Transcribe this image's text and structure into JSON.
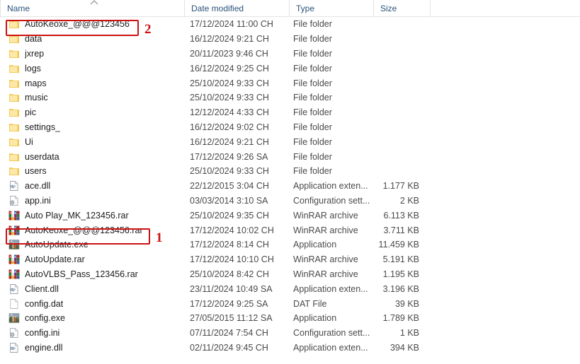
{
  "window": {
    "title": "File Explorer list view"
  },
  "columns": {
    "name": "Name",
    "date_modified": "Date modified",
    "type": "Type",
    "size": "Size",
    "sort_indicator": "sort-ascending-chevron",
    "sorted_by": "Name",
    "sort_direction": "ascending"
  },
  "annotations": [
    {
      "id": "1",
      "label": "1",
      "target": "AutoKeoxe_@@@123456.rar"
    },
    {
      "id": "2",
      "label": "2",
      "target": "AutoKeoxe_@@@123456"
    }
  ],
  "colors": {
    "annotation_red": "#cc1111",
    "folder_yellow": "#fcd975",
    "folder_yellow_dark": "#e8b93c",
    "header_text": "#29527a",
    "row_text": "#1c1c1c",
    "secondary_text": "#4a4a4a"
  },
  "rows": [
    {
      "name": "AutoKeoxe_@@@123456",
      "icon": "folder-icon",
      "date": "17/12/2024 11:00 CH",
      "type": "File folder",
      "size": ""
    },
    {
      "name": "data",
      "icon": "folder-icon",
      "date": "16/12/2024 9:21 CH",
      "type": "File folder",
      "size": ""
    },
    {
      "name": "jxrep",
      "icon": "folder-icon",
      "date": "20/11/2023 9:46 CH",
      "type": "File folder",
      "size": ""
    },
    {
      "name": "logs",
      "icon": "folder-icon",
      "date": "16/12/2024 9:25 CH",
      "type": "File folder",
      "size": ""
    },
    {
      "name": "maps",
      "icon": "folder-icon",
      "date": "25/10/2024 9:33 CH",
      "type": "File folder",
      "size": ""
    },
    {
      "name": "music",
      "icon": "folder-icon",
      "date": "25/10/2024 9:33 CH",
      "type": "File folder",
      "size": ""
    },
    {
      "name": "pic",
      "icon": "folder-icon",
      "date": "12/12/2024 4:33 CH",
      "type": "File folder",
      "size": ""
    },
    {
      "name": "settings_",
      "icon": "folder-icon",
      "date": "16/12/2024 9:02 CH",
      "type": "File folder",
      "size": ""
    },
    {
      "name": "Ui",
      "icon": "folder-icon",
      "date": "16/12/2024 9:21 CH",
      "type": "File folder",
      "size": ""
    },
    {
      "name": "userdata",
      "icon": "folder-icon",
      "date": "17/12/2024 9:26 SA",
      "type": "File folder",
      "size": ""
    },
    {
      "name": "users",
      "icon": "folder-icon",
      "date": "25/10/2024 9:33 CH",
      "type": "File folder",
      "size": ""
    },
    {
      "name": "ace.dll",
      "icon": "dll-icon",
      "date": "22/12/2015 3:04 CH",
      "type": "Application exten...",
      "size": "1.177 KB"
    },
    {
      "name": "app.ini",
      "icon": "ini-icon",
      "date": "03/03/2014 3:10 SA",
      "type": "Configuration sett...",
      "size": "2 KB"
    },
    {
      "name": "Auto Play_MK_123456.rar",
      "icon": "winrar-icon",
      "date": "25/10/2024 9:35 CH",
      "type": "WinRAR archive",
      "size": "6.113 KB"
    },
    {
      "name": "AutoKeoxe_@@@123456.rar",
      "icon": "winrar-icon",
      "date": "17/12/2024 10:02 CH",
      "type": "WinRAR archive",
      "size": "3.711 KB"
    },
    {
      "name": "AutoUpdate.exe",
      "icon": "app-photo-icon",
      "date": "17/12/2024 8:14 CH",
      "type": "Application",
      "size": "11.459 KB"
    },
    {
      "name": "AutoUpdate.rar",
      "icon": "winrar-icon",
      "date": "17/12/2024 10:10 CH",
      "type": "WinRAR archive",
      "size": "5.191 KB"
    },
    {
      "name": "AutoVLBS_Pass_123456.rar",
      "icon": "winrar-icon",
      "date": "25/10/2024 8:42 CH",
      "type": "WinRAR archive",
      "size": "1.195 KB"
    },
    {
      "name": "Client.dll",
      "icon": "dll-icon",
      "date": "23/11/2024 10:49 SA",
      "type": "Application exten...",
      "size": "3.196 KB"
    },
    {
      "name": "config.dat",
      "icon": "blank-doc-icon",
      "date": "17/12/2024 9:25 SA",
      "type": "DAT File",
      "size": "39 KB"
    },
    {
      "name": "config.exe",
      "icon": "app-photo-icon",
      "date": "27/05/2015 11:12 SA",
      "type": "Application",
      "size": "1.789 KB"
    },
    {
      "name": "config.ini",
      "icon": "ini-icon",
      "date": "07/11/2024 7:54 CH",
      "type": "Configuration sett...",
      "size": "1 KB"
    },
    {
      "name": "engine.dll",
      "icon": "dll-icon",
      "date": "02/11/2024 9:45 CH",
      "type": "Application exten...",
      "size": "394 KB"
    }
  ]
}
